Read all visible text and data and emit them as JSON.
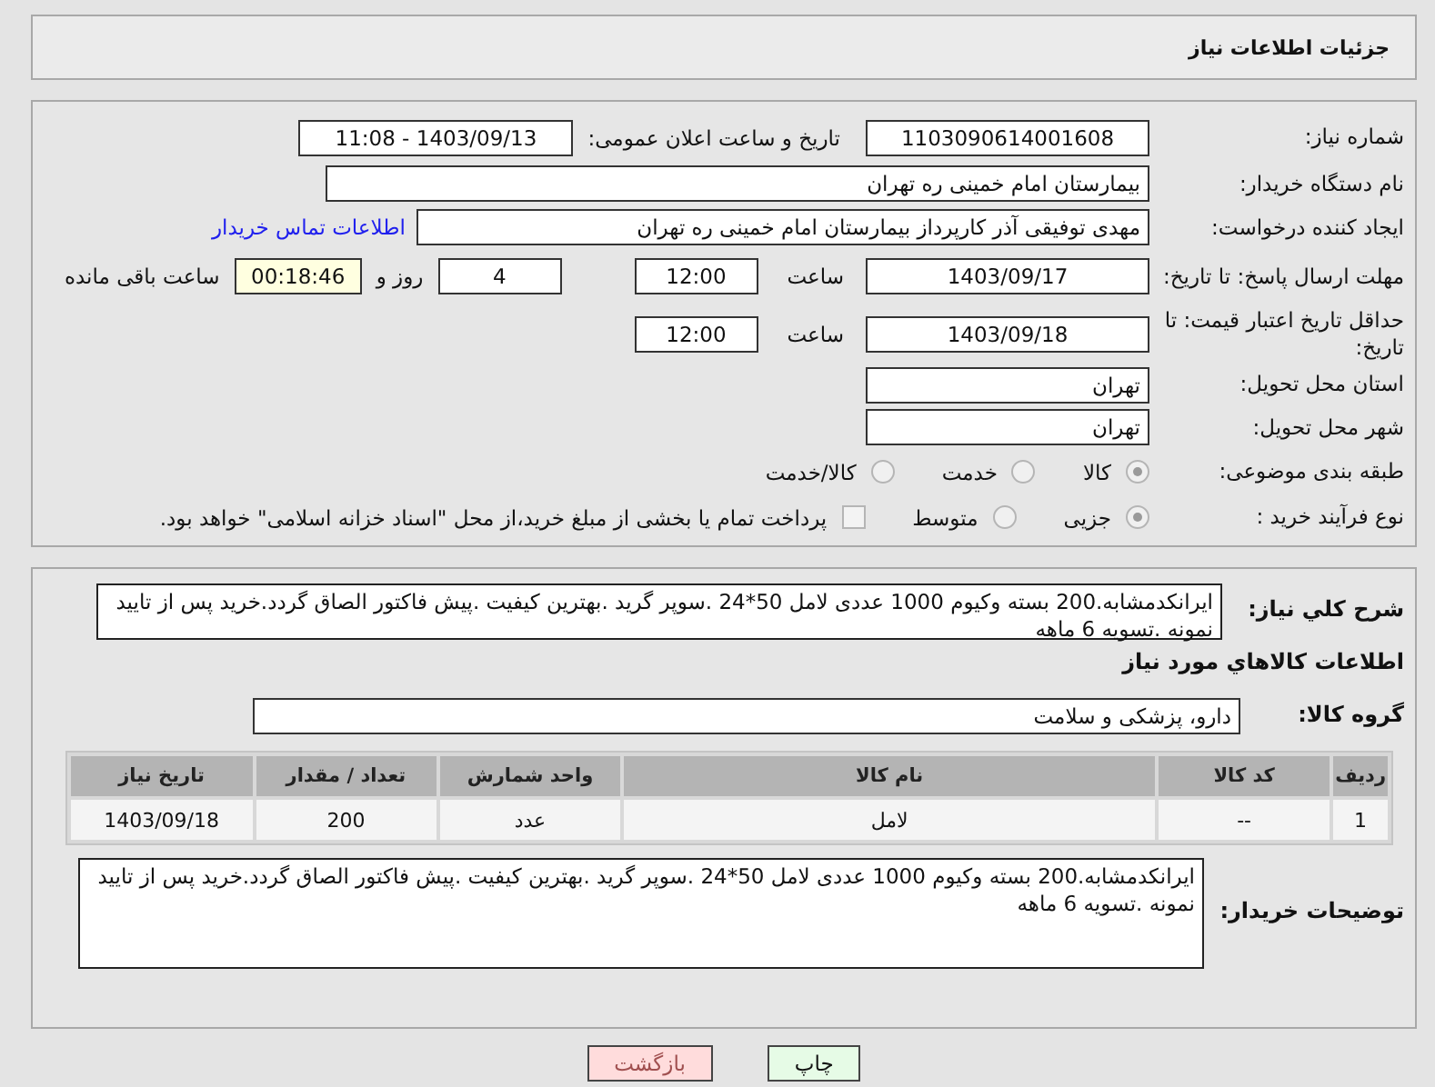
{
  "title": "جزئیات اطلاعات نیاز",
  "need_number": {
    "label": "شماره نیاز:",
    "value": "1103090614001608"
  },
  "announce": {
    "label": "تاریخ و ساعت اعلان عمومی:",
    "value": "1403/09/13 - 11:08"
  },
  "buyer_org": {
    "label": "نام دستگاه خریدار:",
    "value": "بیمارستان امام خمینی ره  تهران"
  },
  "requester": {
    "label": "ایجاد کننده درخواست:",
    "value": "مهدی توفیقی آذر کارپرداز بیمارستان امام خمینی ره  تهران",
    "link": "اطلاعات تماس خریدار"
  },
  "deadline": {
    "label": "مهلت ارسال پاسخ: تا تاریخ:",
    "date": "1403/09/17",
    "time_label": "ساعت",
    "time": "12:00",
    "days": "4",
    "days_label": "روز و",
    "remaining": "00:18:46",
    "remaining_label": "ساعت باقی مانده"
  },
  "validity": {
    "label": "حداقل تاریخ اعتبار قیمت: تا تاریخ:",
    "date": "1403/09/18",
    "time_label": "ساعت",
    "time": "12:00"
  },
  "province": {
    "label": "استان محل تحویل:",
    "value": "تهران"
  },
  "city": {
    "label": "شهر محل تحویل:",
    "value": "تهران"
  },
  "category": {
    "label": "طبقه بندی موضوعی:",
    "options": [
      {
        "label": "کالا",
        "selected": true
      },
      {
        "label": "خدمت",
        "selected": false
      },
      {
        "label": "کالا/خدمت",
        "selected": false
      }
    ]
  },
  "process": {
    "label": "نوع فرآیند خرید :",
    "options": [
      {
        "label": "جزیی",
        "selected": true
      },
      {
        "label": "متوسط",
        "selected": false
      }
    ],
    "treasury": {
      "label": "پرداخت تمام یا بخشی از مبلغ خرید،از محل \"اسناد خزانه اسلامی\" خواهد بود.",
      "checked": false
    }
  },
  "description": {
    "label": "شرح کلي نياز:",
    "value": "ایرانکدمشابه.200 بسته وکیوم 1000 عددی لامل 50*24 .سوپر گرید .بهترین کیفیت .پیش فاکتور  الصاق گردد.خرید پس از تایید نمونه .تسویه 6 ماهه"
  },
  "goods_heading": "اطلاعات کالاهاي مورد نياز",
  "goods_group": {
    "label": "گروه کالا:",
    "value": "دارو، پزشکی و سلامت"
  },
  "table": {
    "columns": [
      "ردیف",
      "کد کالا",
      "نام کالا",
      "واحد شمارش",
      "تعداد / مقدار",
      "تاریخ نیاز"
    ],
    "rows": [
      [
        "1",
        "--",
        "لامل",
        "عدد",
        "200",
        "1403/09/18"
      ]
    ]
  },
  "buyer_notes": {
    "label": "توضیحات خریدار:",
    "value": "ایرانکدمشابه.200 بسته وکیوم 1000 عددی لامل 50*24 .سوپر گرید .بهترین کیفیت .پیش فاکتور  الصاق گردد.خرید پس از تایید نمونه .تسویه 6 ماهه"
  },
  "buttons": [
    {
      "label": "چاپ",
      "kind": "print"
    },
    {
      "label": "بازگشت",
      "kind": "back"
    }
  ]
}
